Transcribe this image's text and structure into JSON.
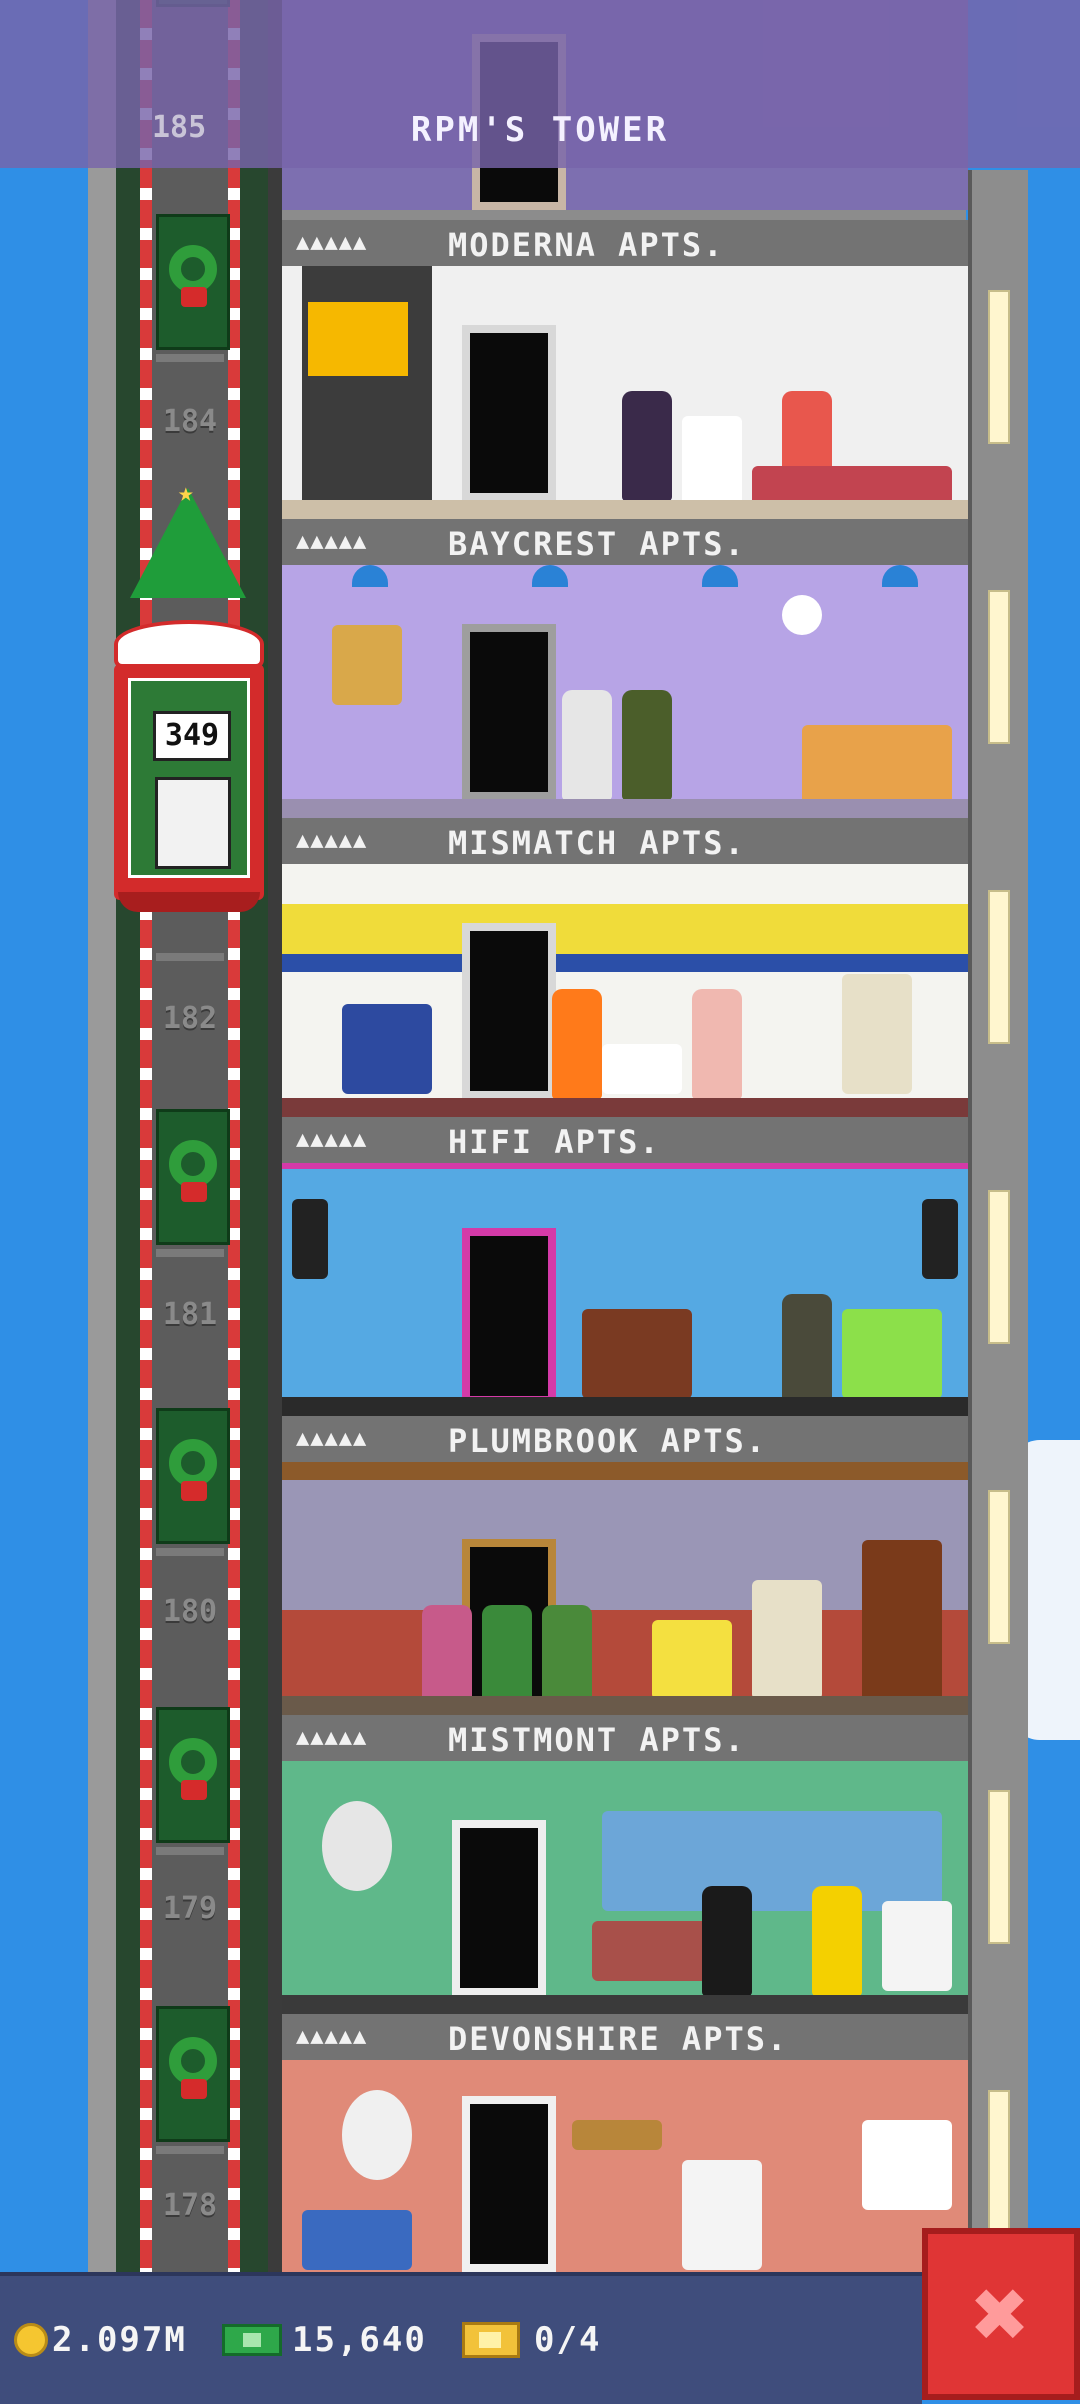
{
  "header": {
    "tower_name": "RPM'S TOWER",
    "top_floor_number": "185"
  },
  "elevator": {
    "display": "349"
  },
  "shaft_floor_numbers": [
    "184",
    "182",
    "181",
    "180",
    "179",
    "178"
  ],
  "stories": [
    {
      "name": "MODERNA APTS.",
      "icon": "occupants-icon"
    },
    {
      "name": "BAYCREST APTS.",
      "icon": "occupants-icon"
    },
    {
      "name": "MISMATCH APTS.",
      "icon": "occupants-icon"
    },
    {
      "name": "HIFI APTS.",
      "icon": "occupants-icon"
    },
    {
      "name": "PLUMBROOK APTS.",
      "icon": "occupants-icon"
    },
    {
      "name": "MISTMONT APTS.",
      "icon": "occupants-icon"
    },
    {
      "name": "DEVONSHIRE APTS.",
      "icon": "occupants-icon"
    }
  ],
  "status_bar": {
    "coins": "2.097M",
    "bux": "15,640",
    "tickets": "0/4"
  },
  "colors": {
    "sky": "#2f8fe6",
    "banner": "#7864aa",
    "bottom_bar": "#3f4d7c",
    "close_button": "#e03535",
    "elevator": "#d32b2b"
  }
}
